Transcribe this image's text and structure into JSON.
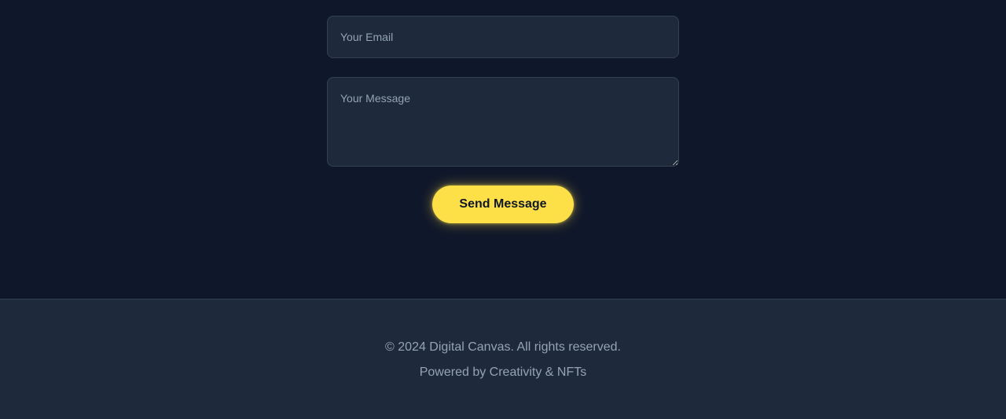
{
  "contact_form": {
    "email_placeholder": "Your Email",
    "email_value": "",
    "message_placeholder": "Your Message",
    "message_value": "",
    "submit_label": "Send Message"
  },
  "footer": {
    "copyright": "© 2024 Digital Canvas. All rights reserved.",
    "powered_by": "Powered by Creativity & NFTs"
  },
  "colors": {
    "background": "#0f172a",
    "surface": "#1e293b",
    "border": "#334155",
    "accent": "#fde047",
    "muted_text": "#94a3b8"
  }
}
